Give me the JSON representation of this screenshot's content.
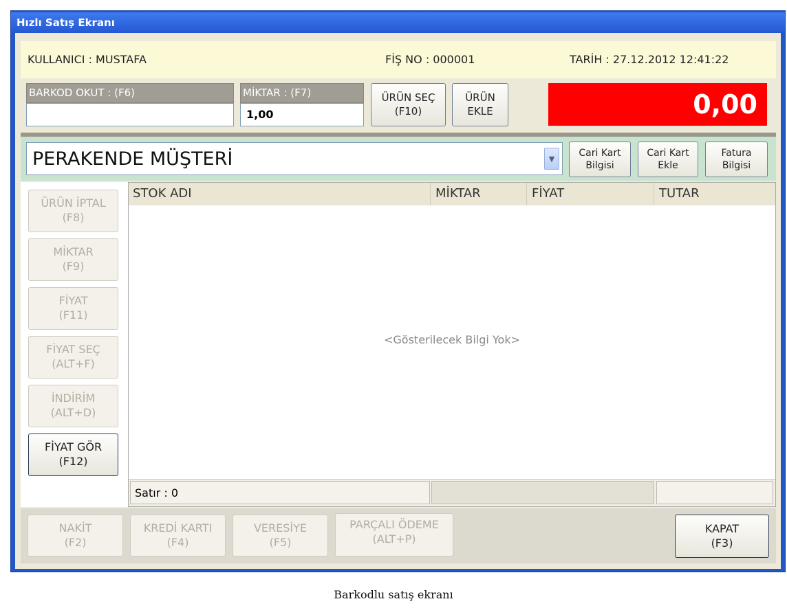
{
  "window": {
    "title": "Hızlı Satış Ekranı"
  },
  "header": {
    "user": "KULLANICI : MUSTAFA",
    "receipt_no": "FİŞ NO : 000001",
    "date": "TARİH : 27.12.2012 12:41:22"
  },
  "barcode": {
    "label": "BARKOD OKUT : (F6)",
    "value": ""
  },
  "quantity": {
    "label": "MİKTAR : (F7)",
    "value": "1,00"
  },
  "toolbar": {
    "select_product": [
      "ÜRÜN SEÇ",
      "(F10)"
    ],
    "add_product": [
      "ÜRÜN",
      "EKLE"
    ]
  },
  "total": "0,00",
  "customer": {
    "selected": "PERAKENDE MÜŞTERİ",
    "card_info": [
      "Cari Kart",
      "Bilgisi"
    ],
    "card_add": [
      "Cari Kart",
      "Ekle"
    ],
    "invoice_info": [
      "Fatura",
      "Bilgisi"
    ]
  },
  "side_buttons": [
    {
      "l1": "ÜRÜN İPTAL",
      "l2": "(F8)"
    },
    {
      "l1": "MİKTAR",
      "l2": "(F9)"
    },
    {
      "l1": "FİYAT",
      "l2": "(F11)"
    },
    {
      "l1": "FİYAT SEÇ",
      "l2": "(ALT+F)"
    },
    {
      "l1": "İNDİRİM",
      "l2": "(ALT+D)"
    },
    {
      "l1": "FİYAT GÖR",
      "l2": "(F12)"
    }
  ],
  "table": {
    "columns": [
      "STOK ADI",
      "MİKTAR",
      "FİYAT",
      "TUTAR"
    ],
    "empty_text": "<Gösterilecek Bilgi Yok>",
    "row_count": "Satır : 0"
  },
  "payment_buttons": [
    {
      "l1": "NAKİT",
      "l2": "(F2)"
    },
    {
      "l1": "KREDİ KARTI",
      "l2": "(F4)"
    },
    {
      "l1": "VERESİYE",
      "l2": "(F5)"
    },
    {
      "l1": "PARÇALI ÖDEME",
      "l2": "(ALT+P)"
    }
  ],
  "close_button": {
    "l1": "KAPAT",
    "l2": "(F3)"
  },
  "caption": "Barkodlu satış ekranı"
}
